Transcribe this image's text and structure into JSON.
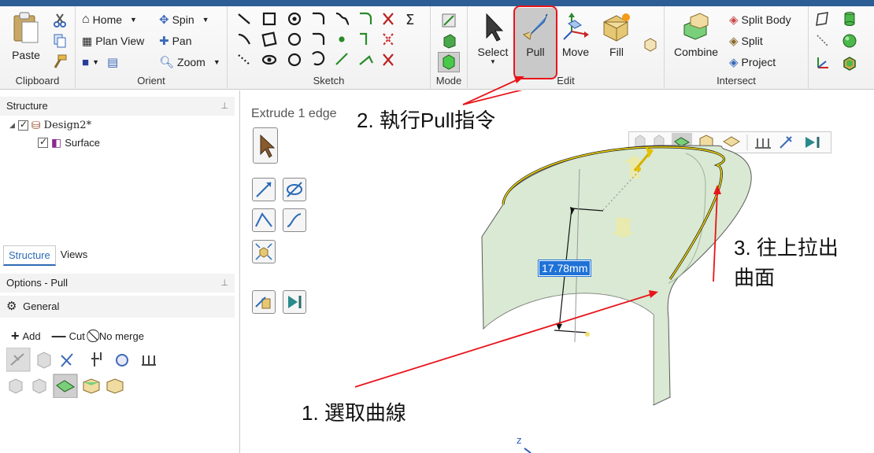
{
  "ribbon": {
    "groups": {
      "clipboard": "Clipboard",
      "orient": "Orient",
      "sketch": "Sketch",
      "mode": "Mode",
      "edit": "Edit",
      "intersect": "Intersect"
    },
    "clipboard": {
      "paste": "Paste"
    },
    "orient": {
      "home": "Home",
      "plan_view": "Plan View",
      "spin": "Spin",
      "pan": "Pan",
      "zoom": "Zoom"
    },
    "sketch": {
      "sigma": "Σ"
    },
    "edit": {
      "select": "Select",
      "pull": "Pull",
      "move": "Move",
      "fill": "Fill"
    },
    "intersect": {
      "combine": "Combine",
      "split_body": "Split Body",
      "split": "Split",
      "project": "Project"
    }
  },
  "structure": {
    "title": "Structure",
    "root": "Design2*",
    "child": "Surface"
  },
  "tabs": [
    "Structure",
    "Views"
  ],
  "options": {
    "title": "Options - Pull",
    "general": "General",
    "add": "Add",
    "cut": "Cut",
    "no_merge": "No merge"
  },
  "viewport": {
    "status": "Extrude 1 edge",
    "dimension": "17.78mm",
    "axis_z": "z"
  },
  "annotations": {
    "step1": "1. 選取曲線",
    "step2": "2. 執行Pull指令",
    "step3_line1": "3. 往上拉出",
    "step3_line2": "曲面"
  },
  "colors": {
    "accent": "#2d5d95",
    "annotation_red": "#e8141a",
    "surface_fill": "#d8e8d3",
    "edge_yellow": "#f5d90a",
    "selection_blue": "#1f72d6"
  }
}
